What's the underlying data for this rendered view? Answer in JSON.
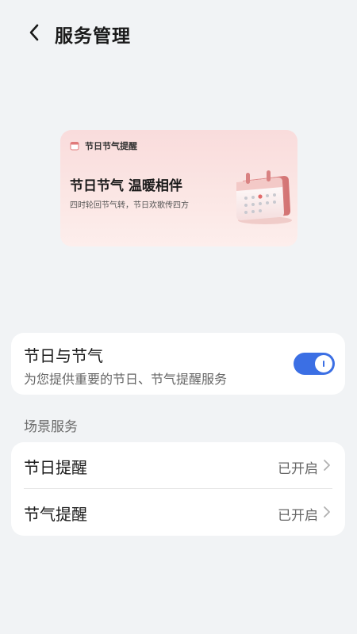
{
  "header": {
    "title": "服务管理",
    "back_icon": "chevron-left-icon"
  },
  "banner": {
    "app_name": "节日节气提醒",
    "headline": "节日节气 温暖相伴",
    "subtitle": "四时轮回节气转，节日欢歌传四方",
    "icon": "calendar-icon",
    "colors": {
      "bg_top": "#f9dcdc",
      "bg_bottom": "#fdeeec"
    }
  },
  "main_toggle": {
    "title": "节日与节气",
    "description": "为您提供重要的节日、节气提醒服务",
    "state": "on",
    "accent_color": "#3b6fe4"
  },
  "scene_section": {
    "label": "场景服务",
    "items": [
      {
        "title": "节日提醒",
        "value": "已开启"
      },
      {
        "title": "节气提醒",
        "value": "已开启"
      }
    ]
  }
}
